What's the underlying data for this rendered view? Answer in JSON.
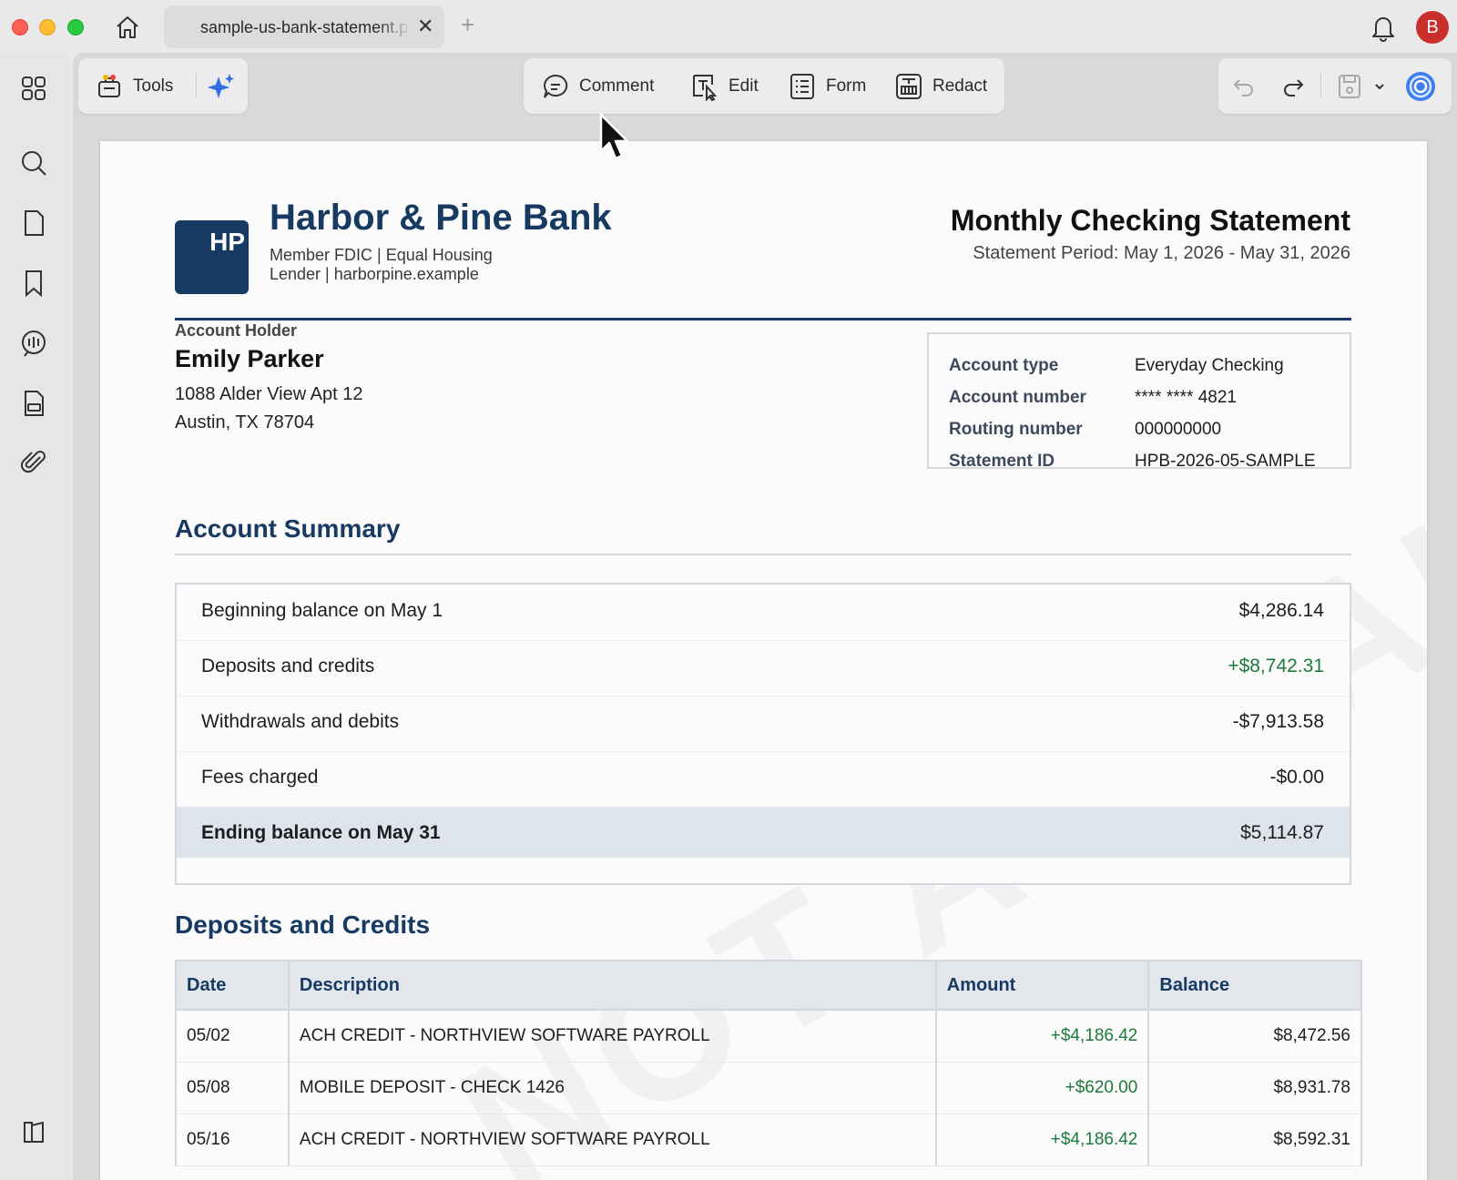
{
  "window": {
    "tab_title": "sample-us-bank-statement.pdf",
    "tab_close": "✕",
    "tab_add": "+",
    "avatar_initial": "B"
  },
  "toolbar": {
    "tools_label": "Tools",
    "comment_label": "Comment",
    "edit_label": "Edit",
    "form_label": "Form",
    "redact_label": "Redact"
  },
  "document": {
    "logo_text": "HP",
    "bank_name": "Harbor & Pine Bank",
    "bank_subtitle": "Member FDIC | Equal Housing Lender | harborpine.example",
    "statement_title": "Monthly Checking Statement",
    "statement_period": "Statement Period: May 1, 2026 - May 31, 2026",
    "watermark": "NOT A REAL STATEMENT",
    "holder": {
      "label": "Account Holder",
      "name": "Emily Parker",
      "address_line1": "1088 Alder View Apt 12",
      "address_line2": "Austin, TX 78704"
    },
    "account_info": [
      {
        "key": "Account type",
        "value": "Everyday Checking"
      },
      {
        "key": "Account number",
        "value": "**** **** 4821"
      },
      {
        "key": "Routing number",
        "value": "000000000"
      },
      {
        "key": "Statement ID",
        "value": "HPB-2026-05-SAMPLE"
      }
    ],
    "summary": {
      "title": "Account Summary",
      "rows": [
        {
          "label": "Beginning balance on May 1",
          "amount": "$4,286.14"
        },
        {
          "label": "Deposits and credits",
          "amount": "+$8,742.31"
        },
        {
          "label": "Withdrawals and debits",
          "amount": "-$7,913.58"
        },
        {
          "label": "Fees charged",
          "amount": "-$0.00"
        },
        {
          "label": "Ending balance on May 31",
          "amount": "$5,114.87"
        }
      ]
    },
    "deposits": {
      "title": "Deposits and Credits",
      "headers": [
        "Date",
        "Description",
        "Amount",
        "Balance"
      ],
      "rows": [
        {
          "date": "05/02",
          "description": "ACH CREDIT - NORTHVIEW SOFTWARE PAYROLL",
          "amount": "+$4,186.42",
          "balance": "$8,472.56"
        },
        {
          "date": "05/08",
          "description": "MOBILE DEPOSIT - CHECK 1426",
          "amount": "+$620.00",
          "balance": "$8,931.78"
        },
        {
          "date": "05/16",
          "description": "ACH CREDIT - NORTHVIEW SOFTWARE PAYROLL",
          "amount": "+$4,186.42",
          "balance": "$8,592.31"
        }
      ]
    }
  },
  "colors": {
    "brand_navy": "#173a63",
    "credit_green": "#1e7a3c",
    "avatar_red": "#c9302c"
  }
}
